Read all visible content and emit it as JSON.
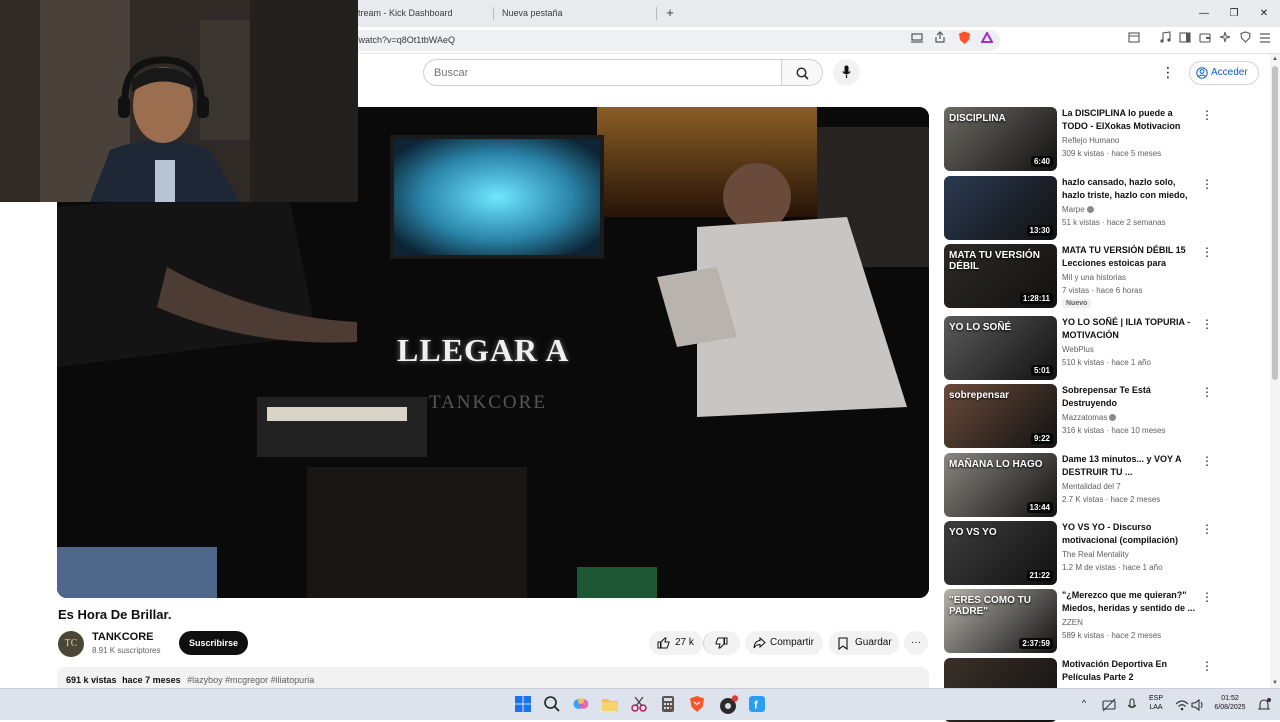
{
  "browser": {
    "tabs": [
      {
        "label": "tream - Kick Dashboard"
      },
      {
        "label": "Nueva pestaña"
      }
    ],
    "new_tab_label": "+",
    "window_controls": {
      "minimize": "—",
      "restore": "❐",
      "close": "✕"
    },
    "url": "/watch?v=q8Ot1tbWAeQ"
  },
  "youtube": {
    "search_placeholder": "Buscar",
    "signin_label": "Acceder",
    "more_label": "⋮"
  },
  "player": {
    "caption": "LLEGAR A",
    "watermark": "TANKCORE"
  },
  "video": {
    "title": "Es Hora De Brillar.",
    "channel_avatar_text": "TC",
    "channel_name": "TANKCORE",
    "subscribers": "8.91 K suscriptores",
    "subscribe_label": "Suscribirse",
    "likes": "27 k",
    "share_label": "Compartir",
    "save_label": "Guardar",
    "more_label": "···",
    "views": "691 k vistas",
    "age": "hace 7 meses",
    "tags": "#lazyboy #mcgregor #iliatopuria"
  },
  "recommendations": [
    {
      "title": "La DISCIPLINA lo puede a TODO - ElXokas Motivacion",
      "channel": "Reflejo Humano",
      "verified": false,
      "views": "309 k vistas",
      "age": "hace 5 meses",
      "duration": "6:40",
      "thumb_text": "DISCIPLINA",
      "thumb_color": "#6d6a64",
      "badge": ""
    },
    {
      "title": "hazlo cansado, hazlo solo, hazlo triste, hazlo con miedo, pero ...",
      "channel": "Marpe",
      "verified": true,
      "views": "51 k vistas",
      "age": "hace 2 semanas",
      "duration": "13:30",
      "thumb_text": "",
      "thumb_color": "#2b3a52",
      "badge": ""
    },
    {
      "title": "MATA TU VERSIÓN DÉBIL 15 Lecciones estoicas para vence...",
      "channel": "Mil y una historias",
      "verified": false,
      "views": "7 vistas",
      "age": "hace 6 horas",
      "duration": "1:28:11",
      "thumb_text": "MATA TU VERSIÓN DÉBIL",
      "thumb_color": "#2e2a26",
      "badge": "Nuevo"
    },
    {
      "title": "YO LO SOÑÉ | ILIA TOPURIA - MOTIVACIÓN",
      "channel": "WebPlus",
      "verified": false,
      "views": "510 k vistas",
      "age": "hace 1 año",
      "duration": "5:01",
      "thumb_text": "YO LO SOÑÉ",
      "thumb_color": "#5b5b5b",
      "badge": ""
    },
    {
      "title": "Sobrepensar Te Está Destruyendo",
      "channel": "Mazzatomas",
      "verified": true,
      "views": "316 k vistas",
      "age": "hace 10 meses",
      "duration": "9:22",
      "thumb_text": "sobrepensar",
      "thumb_color": "#6a4b3a",
      "badge": ""
    },
    {
      "title": "Dame 13 minutos... y VOY A DESTRUIR TU ...",
      "channel": "Mentalidad del 7",
      "verified": false,
      "views": "2.7 K vistas",
      "age": "hace 2 meses",
      "duration": "13:44",
      "thumb_text": "MAÑANA LO HAGO",
      "thumb_color": "#8a8680",
      "badge": ""
    },
    {
      "title": "YO VS YO - Discurso motivacional (compilación)",
      "channel": "The Real Mentality",
      "verified": false,
      "views": "1.2 M de vistas",
      "age": "hace 1 año",
      "duration": "21:22",
      "thumb_text": "YO VS YO",
      "thumb_color": "#3d3d3d",
      "badge": ""
    },
    {
      "title": "\"¿Merezco que me quieran?\" Miedos, heridas y sentido de ...",
      "channel": "ZZEN",
      "verified": false,
      "views": "589 k vistas",
      "age": "hace 2 meses",
      "duration": "2:37:59",
      "thumb_text": "\"ERES COMO TU PADRE\"",
      "thumb_color": "#b7b2ab",
      "badge": ""
    },
    {
      "title": "Motivación Deportiva En Películas Parte 2",
      "channel": "",
      "verified": false,
      "views": "",
      "age": "",
      "duration": "",
      "thumb_text": "",
      "thumb_color": "#3b3028",
      "badge": ""
    }
  ],
  "taskbar": {
    "language_top": "ESP",
    "language_bottom": "LAA",
    "time": "01:52",
    "date": "6/08/2025"
  }
}
